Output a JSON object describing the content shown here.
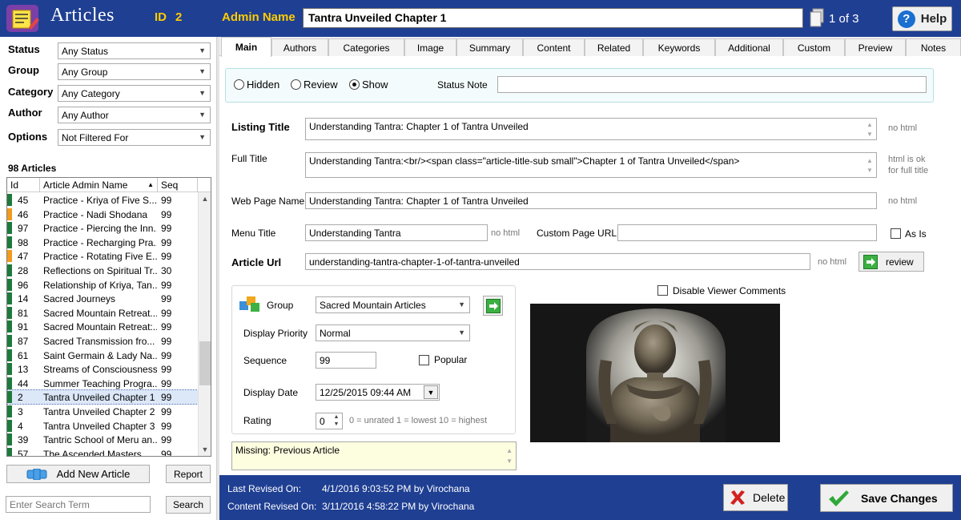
{
  "header": {
    "title": "Articles",
    "id_label": "ID",
    "id_value": "2",
    "admin_name_label": "Admin Name",
    "admin_name_value": "Tantra Unveiled Chapter 1",
    "pager": "1 of 3",
    "help_label": "Help"
  },
  "filters": {
    "status_label": "Status",
    "status_value": "Any Status",
    "group_label": "Group",
    "group_value": "Any Group",
    "category_label": "Category",
    "category_value": "Any Category",
    "author_label": "Author",
    "author_value": "Any Author",
    "options_label": "Options",
    "options_value": "Not Filtered For"
  },
  "list": {
    "count": "98 Articles",
    "columns": [
      "Id",
      "Article Admin Name",
      "Seq"
    ],
    "rows": [
      {
        "id": "45",
        "name": "Practice - Kriya of Five S...",
        "seq": "99",
        "mark": "green"
      },
      {
        "id": "46",
        "name": "Practice - Nadi Shodana",
        "seq": "99",
        "mark": "orange"
      },
      {
        "id": "97",
        "name": "Practice - Piercing the Inn...",
        "seq": "99",
        "mark": "green"
      },
      {
        "id": "98",
        "name": "Practice - Recharging Pra...",
        "seq": "99",
        "mark": "green"
      },
      {
        "id": "47",
        "name": "Practice - Rotating Five E...",
        "seq": "99",
        "mark": "orange"
      },
      {
        "id": "28",
        "name": "Reflections on Spiritual Tr...",
        "seq": "30",
        "mark": "green"
      },
      {
        "id": "96",
        "name": "Relationship of Kriya, Tan...",
        "seq": "99",
        "mark": "green"
      },
      {
        "id": "14",
        "name": "Sacred Journeys",
        "seq": "99",
        "mark": "green"
      },
      {
        "id": "81",
        "name": "Sacred Mountain Retreat...",
        "seq": "99",
        "mark": "green"
      },
      {
        "id": "91",
        "name": "Sacred Mountain Retreat:...",
        "seq": "99",
        "mark": "green"
      },
      {
        "id": "87",
        "name": "Sacred Transmission fro...",
        "seq": "99",
        "mark": "green"
      },
      {
        "id": "61",
        "name": "Saint Germain & Lady Na...",
        "seq": "99",
        "mark": "green"
      },
      {
        "id": "13",
        "name": "Streams of Consciousness",
        "seq": "99",
        "mark": "green"
      },
      {
        "id": "44",
        "name": "Summer Teaching Progra...",
        "seq": "99",
        "mark": "green"
      },
      {
        "id": "2",
        "name": "Tantra Unveiled Chapter 1",
        "seq": "99",
        "mark": "green",
        "selected": true
      },
      {
        "id": "3",
        "name": "Tantra Unveiled Chapter 2",
        "seq": "99",
        "mark": "green"
      },
      {
        "id": "4",
        "name": "Tantra Unveiled Chapter 3",
        "seq": "99",
        "mark": "green"
      },
      {
        "id": "39",
        "name": "Tantric School of Meru an...",
        "seq": "99",
        "mark": "green"
      },
      {
        "id": "57",
        "name": "The Ascended Masters",
        "seq": "99",
        "mark": "green"
      }
    ]
  },
  "left_buttons": {
    "add_new": "Add New Article",
    "report": "Report",
    "search_placeholder": "Enter Search Term",
    "search": "Search"
  },
  "tabs": [
    "Main",
    "Authors",
    "Categories",
    "Image",
    "Summary",
    "Content",
    "Related",
    "Keywords",
    "Additional",
    "Custom",
    "Preview",
    "Notes"
  ],
  "main": {
    "status": {
      "hidden": "Hidden",
      "review": "Review",
      "show": "Show",
      "selected": "Show",
      "status_note_label": "Status Note",
      "status_note_value": ""
    },
    "listing_title_label": "Listing Title",
    "listing_title_value": "Understanding Tantra: Chapter 1 of Tantra Unveiled",
    "listing_title_note": "no html",
    "full_title_label": "Full Title",
    "full_title_value": "Understanding Tantra:<br/><span class=\"article-title-sub small\">Chapter 1 of Tantra Unveiled</span>",
    "full_title_note_1": "html is ok",
    "full_title_note_2": "for full title",
    "web_page_name_label": "Web Page Name",
    "web_page_name_value": "Understanding Tantra: Chapter 1 of Tantra Unveiled",
    "web_page_name_note": "no html",
    "menu_title_label": "Menu Title",
    "menu_title_value": "Understanding Tantra",
    "menu_title_note": "no html",
    "custom_url_label": "Custom Page URL",
    "custom_url_value": "",
    "as_is_label": "As Is",
    "article_url_label": "Article Url",
    "article_url_value": "understanding-tantra-chapter-1-of-tantra-unveiled",
    "article_url_note": "no html",
    "review_label": "review",
    "disable_comments_label": "Disable Viewer Comments",
    "group_label": "Group",
    "group_value": "Sacred Mountain Articles",
    "display_priority_label": "Display Priority",
    "display_priority_value": "Normal",
    "sequence_label": "Sequence",
    "sequence_value": "99",
    "popular_label": "Popular",
    "display_date_label": "Display Date",
    "display_date_value": "12/25/2015 09:44 AM",
    "rating_label": "Rating",
    "rating_value": "0",
    "rating_note": "0 = unrated 1 = lowest 10 = highest",
    "missing": "Missing: Previous Article"
  },
  "footer": {
    "last_revised_label": "Last Revised On:",
    "last_revised_value": "4/1/2016 9:03:52 PM by Virochana",
    "content_revised_label": "Content Revised On:",
    "content_revised_value": "3/11/2016 4:58:22 PM by Virochana",
    "delete": "Delete",
    "save": "Save Changes"
  },
  "colors": {
    "header_bg": "#1f3f92",
    "accent": "#ffcc00",
    "mark_green": "#1e7a3c",
    "mark_orange": "#f29a1d"
  }
}
